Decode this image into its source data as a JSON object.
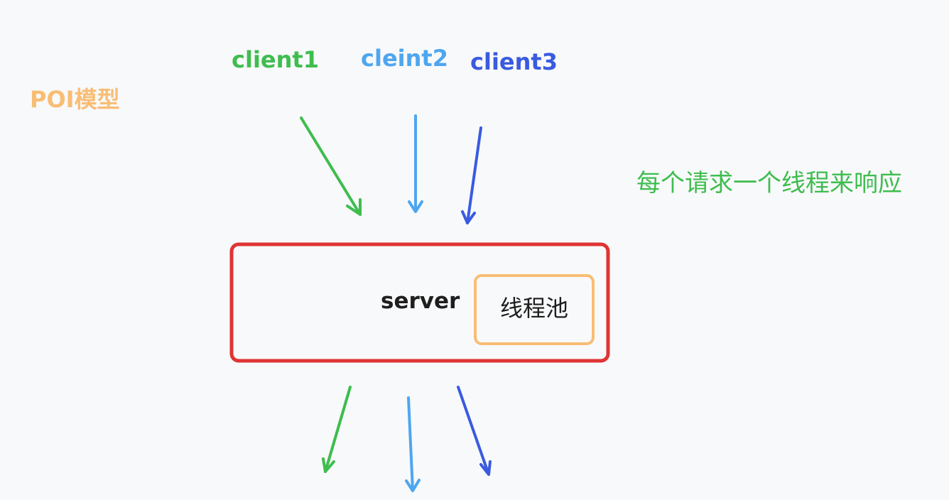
{
  "title": "POI模型",
  "clients": [
    "client1",
    "cleint2",
    "client3"
  ],
  "note": "每个请求一个线程来响应",
  "server": "server",
  "thread_pool": "线程池",
  "colors": {
    "background": "#f8f9fb",
    "title": "#f9bd74",
    "client1": "#3ebd4e",
    "client2": "#4ea6ef",
    "client3": "#3a5be0",
    "note": "#3ebd4e",
    "server_border": "#e03434",
    "pool_border": "#f9bd74",
    "text_dark": "#1e1e1e"
  }
}
